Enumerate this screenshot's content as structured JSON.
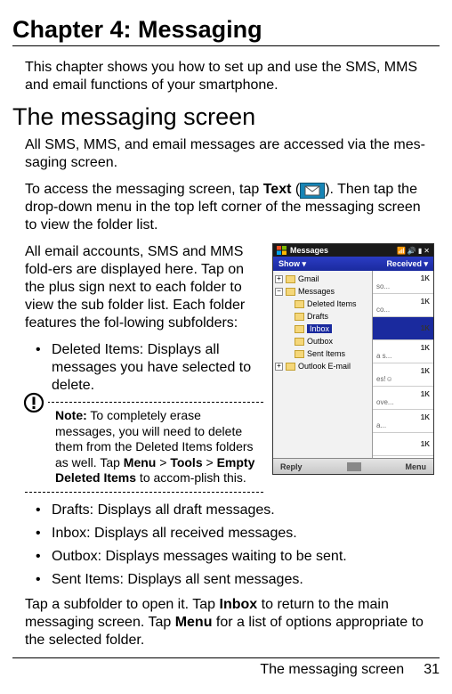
{
  "chapter_title": "Chapter 4: Messaging",
  "intro": "This chapter shows you how to set up and use the SMS, MMS and email functions of your smartphone.",
  "section_title": "The messaging screen",
  "p1": "All SMS, MMS, and email messages are accessed via the mes-saging screen.",
  "p2a": "To access the messaging screen, tap ",
  "p2b_bold": "Text",
  "p2c": " (",
  "p2d": "). Then tap the drop-down menu in the top left corner of the messaging screen to view the folder list.",
  "p3": "All email accounts, SMS and MMS fold-ers are displayed here. Tap on the plus sign next to each folder to view the sub folder list. Each folder features the fol-lowing subfolders:",
  "bullet_deleted": "Deleted Items: Displays all messages you have selected to delete.",
  "note_prefix": "Note:",
  "note_a": " To completely erase messages, you will need to delete them from the Deleted Items folders as well. Tap ",
  "note_menu": "Menu",
  "note_gt": " > ",
  "note_tools": "Tools",
  "note_empty": "Empty Deleted Items",
  "note_end": " to accom-plish this.",
  "bullet_drafts": "Drafts: Displays all draft messages.",
  "bullet_inbox": "Inbox: Displays all received messages.",
  "bullet_outbox": "Outbox: Displays messages waiting to be sent.",
  "bullet_sent": "Sent Items: Displays all sent messages.",
  "tail_a": "Tap a subfolder to open it. Tap ",
  "tail_inbox": "Inbox",
  "tail_b": " to return to the main messaging screen. Tap ",
  "tail_menu": "Menu",
  "tail_c": " for a list of options appropriate to the selected folder.",
  "footer_title": "The messaging screen",
  "footer_page": "31",
  "phone": {
    "title": "Messages",
    "show": "Show",
    "received": "Received",
    "tree": {
      "gmail": "Gmail",
      "messages": "Messages",
      "deleted": "Deleted Items",
      "drafts": "Drafts",
      "inbox": "Inbox",
      "outbox": "Outbox",
      "sent": "Sent Items",
      "outlook": "Outlook E-mail"
    },
    "list": [
      {
        "size": "1K",
        "sub": "so..."
      },
      {
        "size": "1K",
        "sub": "co..."
      },
      {
        "size": "1K",
        "sub": ""
      },
      {
        "size": "1K",
        "sub": "a s..."
      },
      {
        "size": "1K",
        "sub": "es!☺"
      },
      {
        "size": "1K",
        "sub": "ove..."
      },
      {
        "size": "1K",
        "sub": "a..."
      },
      {
        "size": "1K",
        "sub": ""
      }
    ],
    "reply": "Reply",
    "menu": "Menu"
  }
}
